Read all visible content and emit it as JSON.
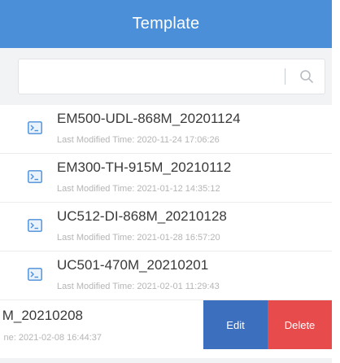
{
  "header": {
    "title": "Template"
  },
  "search": {
    "value": "",
    "placeholder": ""
  },
  "templates": [
    {
      "name": "EM500-UDL-868M_20201124",
      "modified": "Last Modified Time: 2020-11-24 17:06:26"
    },
    {
      "name": "EM300-TH-915M_20210112",
      "modified": "Last Modified Time: 2021-01-12 14:35:12"
    },
    {
      "name": "UC512-DI-868M_20210128",
      "modified": "Last Modified Time: 2021-01-28 16:57:20"
    },
    {
      "name": "UC501-470M_20210201",
      "modified": "Last Modified Time: 2021-02-01 11:29:43"
    }
  ],
  "swiped_row": {
    "name_visible": "M_20210208",
    "modified_visible": "ne: 2021-02-08 16:44:37",
    "edit_label": "Edit",
    "delete_label": "Delete"
  },
  "colors": {
    "header": "#4a8fd8",
    "edit": "#3d6fbf",
    "delete": "#e84b4b",
    "icon": "#4a8fd8"
  },
  "icons": {
    "search": "search-icon",
    "template": "template-file-icon"
  }
}
